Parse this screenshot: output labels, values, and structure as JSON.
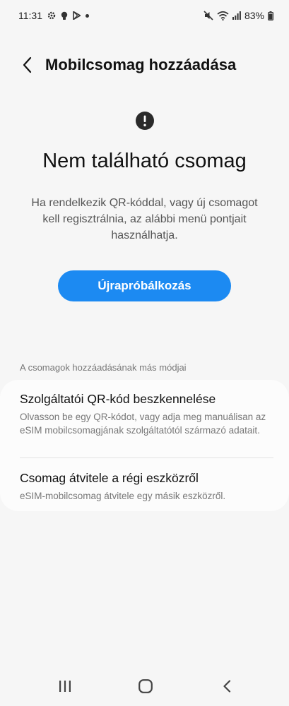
{
  "status_bar": {
    "time": "11:31",
    "battery": "83%",
    "left_icons": [
      "settings-icon",
      "bulb-icon",
      "play-store-icon",
      "dot-icon"
    ],
    "right_icons": [
      "mute-icon",
      "wifi-icon",
      "signal-icon",
      "battery-icon"
    ]
  },
  "header": {
    "title": "Mobilcsomag hozzáadása",
    "back_icon": "chevron-left-icon"
  },
  "main": {
    "alert_icon": "exclamation-circle-icon",
    "heading": "Nem található csomag",
    "description": "Ha rendelkezik QR-kóddal, vagy új csomagot kell regisztrálnia, az alábbi menü pontjait használhatja.",
    "retry_label": "Újrapróbálkozás"
  },
  "other_ways": {
    "section_label": "A csomagok hozzáadásának más módjai",
    "items": [
      {
        "title": "Szolgáltatói QR-kód beszkennelése",
        "description": "Olvasson be egy QR-kódot, vagy adja meg manuálisan az eSIM mobilcsomagjának szolgáltatótól származó adatait."
      },
      {
        "title": "Csomag átvitele a régi eszközről",
        "description": "eSIM-mobilcsomag átvitele egy másik eszközről."
      }
    ]
  },
  "nav_bar": {
    "icons": [
      "recents-icon",
      "home-icon",
      "back-icon"
    ]
  },
  "colors": {
    "accent": "#1c8af2",
    "background": "#f6f6f6",
    "card": "#fcfcfc"
  }
}
